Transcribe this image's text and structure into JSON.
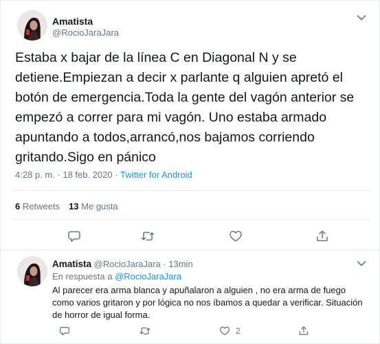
{
  "main_tweet": {
    "author_name": "Amatista",
    "author_handle": "@RocioJaraJara",
    "text": "Estaba x bajar de la línea C en Diagonal N y se detiene.Empiezan a decir x parlante q alguien apretó el botón de emergencia.Toda la gente del vagón anterior se empezó a correr para mi vagón. Uno estaba armado apuntando a todos,arrancó,nos bajamos corriendo gritando.Sigo en pánico",
    "time": "4:28 p. m. · 18 feb. 2020 ·",
    "source": "Twitter for Android",
    "retweets_count": "6",
    "retweets_label": "Retweets",
    "likes_count": "13",
    "likes_label": "Me gusta",
    "icons": [
      "reply-icon",
      "retweet-icon",
      "like-icon",
      "share-icon",
      "chevron-down-icon"
    ]
  },
  "reply_tweet": {
    "author_name": "Amatista",
    "author_handle": "@RocioJaraJara",
    "time_sep": "·",
    "time": "13min",
    "replying_prefix": "En respuesta a",
    "replying_to": "@RocioJaraJara",
    "text": "Al parecer era arma blanca y apuñalaron a alguien , no era arma de fuego como varios gritaron y por lógica no nos íbamos a quedar a verificar. Situación de horror de igual forma.",
    "like_count": "2",
    "icons": [
      "reply-icon",
      "retweet-icon",
      "like-icon",
      "share-icon",
      "chevron-down-icon"
    ]
  },
  "colors": {
    "text": "#14171a",
    "secondary": "#657786",
    "link": "#1b95e0",
    "border": "#e6ecf0"
  }
}
